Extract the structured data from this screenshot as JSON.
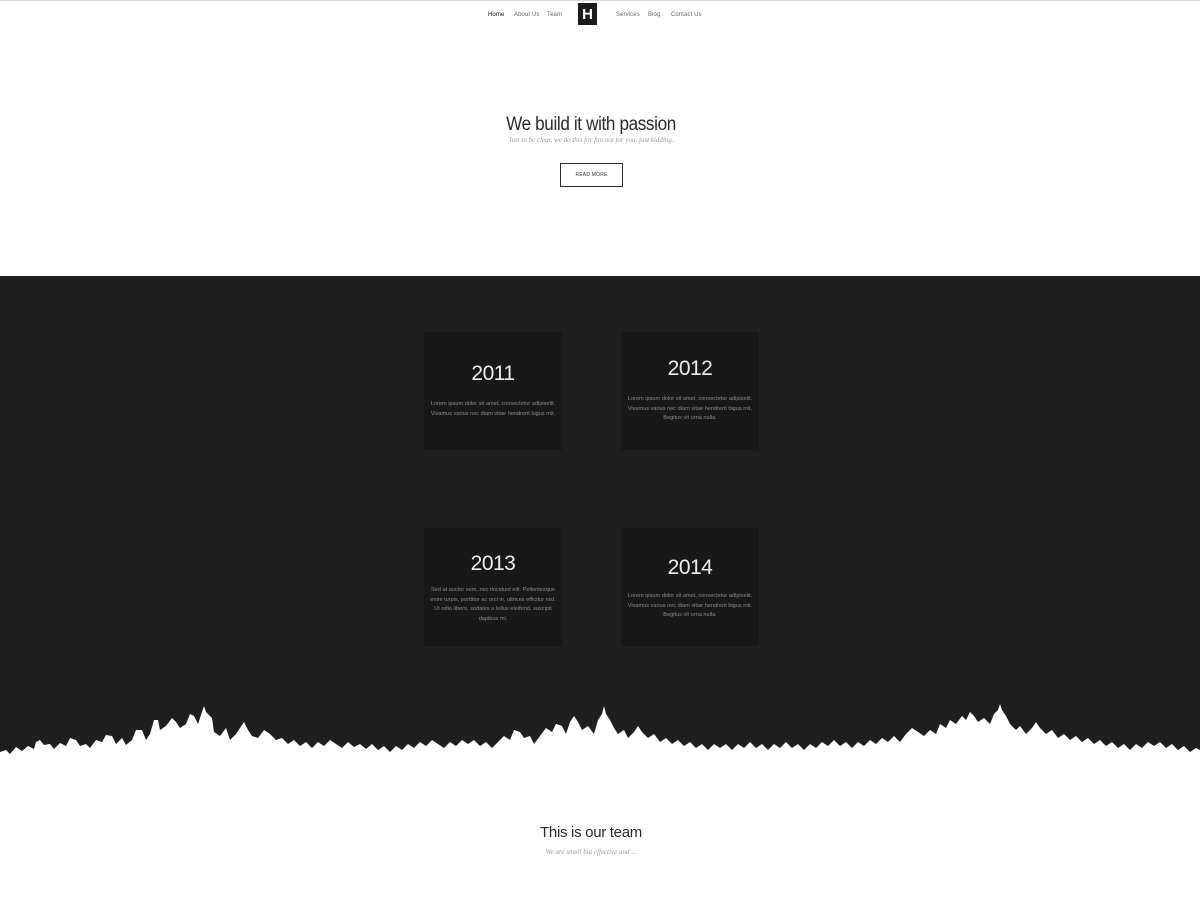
{
  "nav": {
    "left": [
      "Home",
      "About Us",
      "Team"
    ],
    "logo": "H",
    "right": [
      "Services",
      "Blog",
      "Contact Us"
    ]
  },
  "hero": {
    "title": "We build it with passion",
    "subtitle": "Just to be clear, we do this for fun not for you, just kidding.",
    "button": "READ MORE"
  },
  "timeline": [
    {
      "year": "2011",
      "text": "Lorem ipsum dolor sit amet, consectetur adipiselit. Vivamus varius nec diam vitae hendrerit bigus mit."
    },
    {
      "year": "2012",
      "text": "Lorem ipsum dolor sit amet, consectetur adipiselit. Vivamus varius nec diam vitae hendrerit bigus mit. Begitus vit urna nulla."
    },
    {
      "year": "2013",
      "text": "Sed at auctor sem, nec tincidunt elit. Pellentesque enim turpis, porttitor ac orci in, ultrices efficitur nisl. Ut odio libero, sodales a tellus eleifend, suscipit dapibus mi."
    },
    {
      "year": "2014",
      "text": "Lorem ipsum dolor sit amet, consectetur adipiselit. Vivamus varius nec diam vitae hendrerit bigus mit. Begitus vit urna nulla."
    }
  ],
  "team": {
    "title": "This is our team",
    "subtitle": "We are small but effective and ..."
  },
  "colors": {
    "dark_band": "#1f1f1f",
    "card": "#181818",
    "accent": "#1b1b1b"
  }
}
